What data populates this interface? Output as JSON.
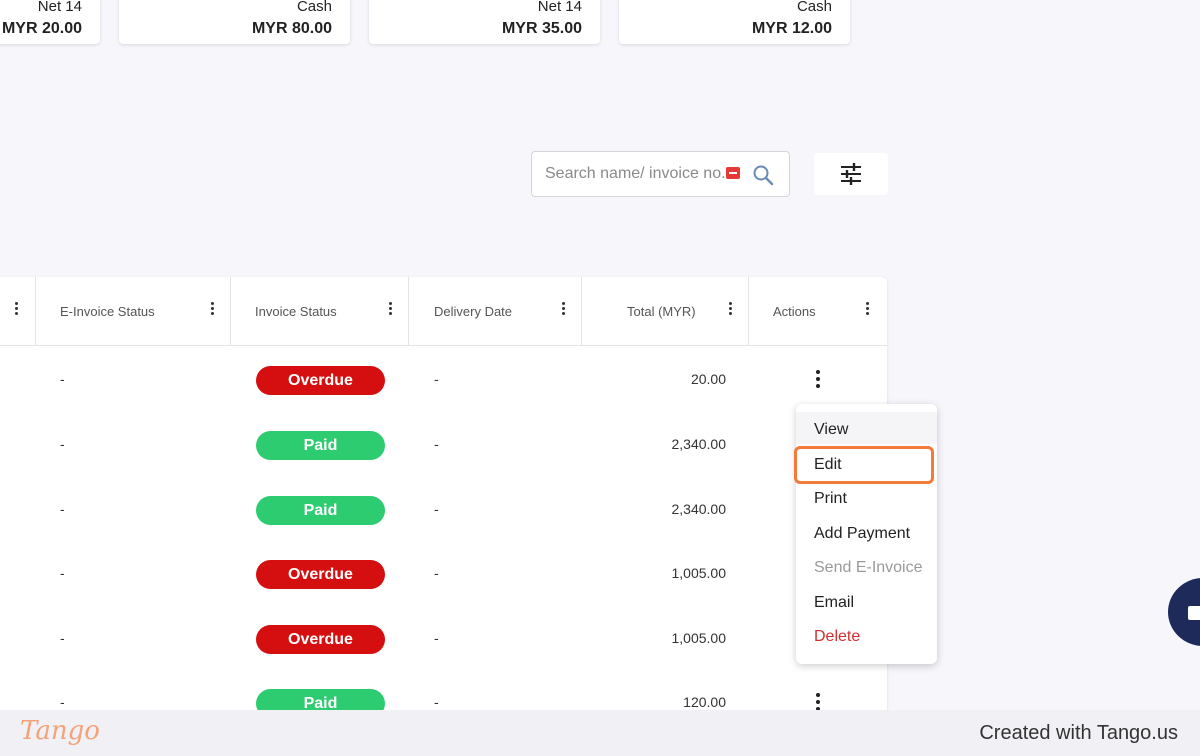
{
  "summary_cards": [
    {
      "term": "Net 14",
      "amount": "MYR 20.00"
    },
    {
      "term": "Cash",
      "amount": "MYR 80.00"
    },
    {
      "term": "Net 14",
      "amount": "MYR 35.00"
    },
    {
      "term": "Cash",
      "amount": "MYR 12.00"
    }
  ],
  "search": {
    "placeholder": "Search name/ invoice no.",
    "icon": "search-icon"
  },
  "filter": {
    "icon": "sliders-icon"
  },
  "table": {
    "columns": [
      "E-Invoice Status",
      "Invoice Status",
      "Delivery Date",
      "Total (MYR)",
      "Actions"
    ],
    "rows": [
      {
        "einvoice": "-",
        "status": "Overdue",
        "delivery": "-",
        "total": "20.00"
      },
      {
        "einvoice": "-",
        "status": "Paid",
        "delivery": "-",
        "total": "2,340.00"
      },
      {
        "einvoice": "-",
        "status": "Paid",
        "delivery": "-",
        "total": "2,340.00"
      },
      {
        "einvoice": "-",
        "status": "Overdue",
        "delivery": "-",
        "total": "1,005.00"
      },
      {
        "einvoice": "-",
        "status": "Overdue",
        "delivery": "-",
        "total": "1,005.00"
      },
      {
        "einvoice": "-",
        "status": "Paid",
        "delivery": "-",
        "total": "120.00"
      }
    ]
  },
  "actions_menu": {
    "items": [
      "View",
      "Edit",
      "Print",
      "Add Payment",
      "Send E-Invoice",
      "Email",
      "Delete"
    ],
    "highlighted": "Edit",
    "disabled": "Send E-Invoice"
  },
  "colors": {
    "overdue": "#d50f0f",
    "paid": "#2ecc71",
    "highlight": "#f47a3b",
    "delete": "#d32f2f"
  },
  "footer": {
    "logo": "Tango",
    "credit": "Created with Tango.us"
  }
}
